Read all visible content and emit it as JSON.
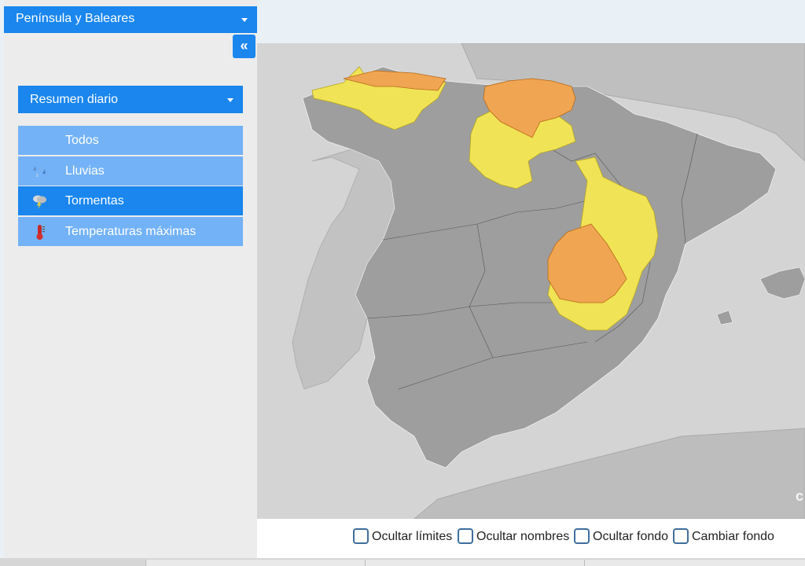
{
  "panel": {
    "region_select": "Península y Baleares",
    "collapse_label": "«",
    "summary_select": "Resumen diario",
    "items": [
      {
        "label": "Todos",
        "icon": "none",
        "active": false
      },
      {
        "label": "Lluvias",
        "icon": "rain-icon",
        "active": false
      },
      {
        "label": "Tormentas",
        "icon": "storm-icon",
        "active": true
      },
      {
        "label": "Temperaturas máximas",
        "icon": "thermometer-icon",
        "active": false
      }
    ]
  },
  "map": {
    "legend_colors": {
      "yellow": "#f0e356",
      "orange": "#f0a552",
      "land": "#9e9e9e",
      "sea": "#d4d4d4"
    },
    "logo_text": "c"
  },
  "controls": {
    "hide_limits": "Ocultar límites",
    "hide_names": "Ocultar nombres",
    "hide_background": "Ocultar fondo",
    "change_background": "Cambiar fondo"
  }
}
